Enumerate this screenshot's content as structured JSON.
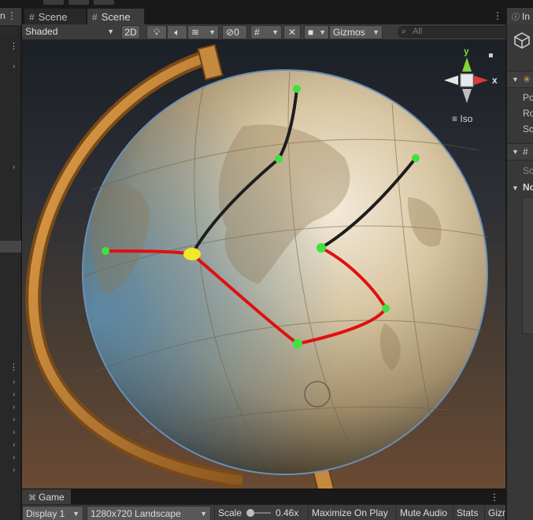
{
  "hierarchy": {
    "tab_fragment": "n",
    "kebab": "⋮"
  },
  "scene_tabs": [
    {
      "label": "Scene"
    },
    {
      "label": "Scene"
    }
  ],
  "toolbar": {
    "shading_mode": "Shaded",
    "mode_2d": "2D",
    "hidden_count": "0",
    "gizmos": "Gizmos",
    "search_placeholder": "All"
  },
  "scene_gizmo": {
    "axis_y": "y",
    "axis_x": "x",
    "projection": "Iso"
  },
  "game": {
    "tab_label": "Game",
    "display": "Display 1",
    "resolution": "1280x720 Landscape",
    "scale_label": "Scale",
    "scale_value": "0.46x",
    "maximize": "Maximize On Play",
    "mute": "Mute Audio",
    "stats": "Stats",
    "gizmos_fragment": "Gizm"
  },
  "inspector": {
    "tab_fragment": "In",
    "rows": [
      "Po",
      "Ro",
      "Sc"
    ],
    "component_fragment": "#",
    "script_fragment": "Sc",
    "list_fragment": "No"
  },
  "colors": {
    "accent_green": "#3fe23f",
    "route_red": "#e01010",
    "route_black": "#1e1e1e",
    "node_yellow": "#f2e82a",
    "axis_y": "#7fd43a",
    "axis_x": "#d93a3a"
  }
}
